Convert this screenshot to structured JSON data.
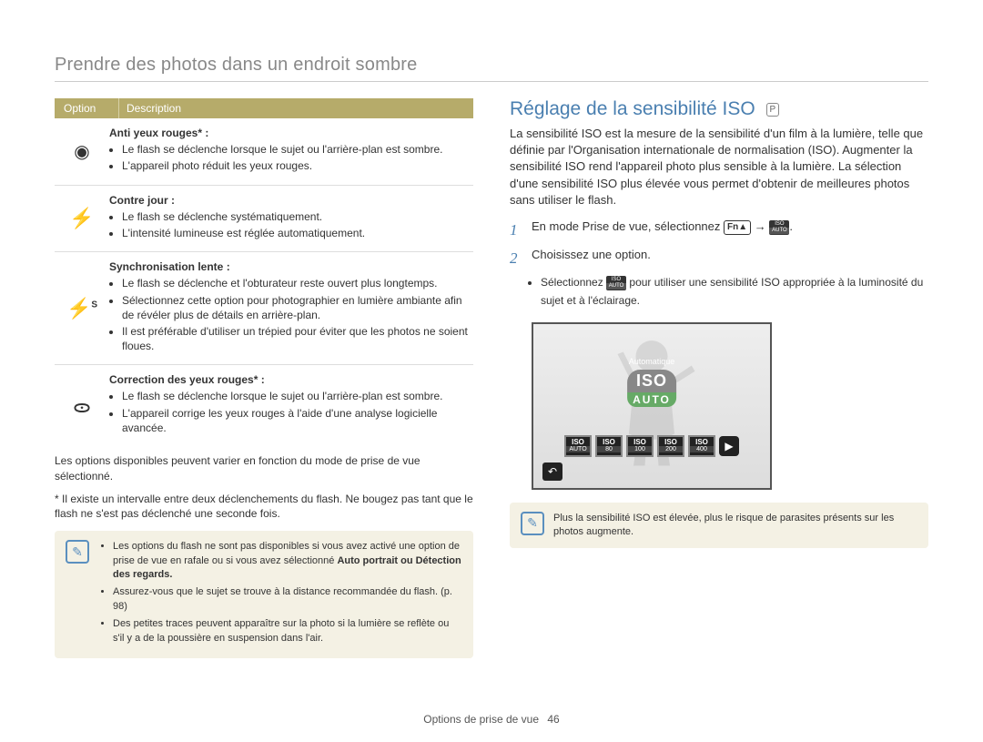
{
  "page_title": "Prendre des photos dans un endroit sombre",
  "table": {
    "header_option": "Option",
    "header_description": "Description",
    "rows": [
      {
        "icon": "eye-icon",
        "title": "Anti yeux rouges* :",
        "bullets": [
          "Le flash se déclenche lorsque le sujet ou l'arrière-plan est sombre.",
          "L'appareil photo réduit les yeux rouges."
        ]
      },
      {
        "icon": "flash-icon",
        "title": "Contre jour :",
        "bullets": [
          "Le flash se déclenche systématiquement.",
          "L'intensité lumineuse est réglée automatiquement."
        ]
      },
      {
        "icon": "flash-slow-icon",
        "title": "Synchronisation lente :",
        "bullets": [
          "Le flash se déclenche et l'obturateur reste ouvert plus longtemps.",
          "Sélectionnez cette option pour photographier en lumière ambiante afin de révéler plus de détails en arrière-plan.",
          "Il est préférable d'utiliser un trépied pour éviter que les photos ne soient floues."
        ]
      },
      {
        "icon": "eye-fix-icon",
        "title": "Correction des yeux rouges* :",
        "bullets": [
          "Le flash se déclenche lorsque le sujet ou l'arrière-plan est sombre.",
          "L'appareil corrige les yeux rouges à l'aide d'une analyse logicielle avancée."
        ]
      }
    ]
  },
  "footnotes": {
    "line1": "Les options disponibles peuvent varier en fonction du mode de prise de vue sélectionné.",
    "line2": "* Il existe un intervalle entre deux déclenchements du flash. Ne bougez pas tant que le flash ne s'est pas déclenché une seconde fois."
  },
  "left_note": {
    "bullets": [
      "Les options du flash ne sont pas disponibles si vous avez activé une option de prise de vue en rafale ou si vous avez sélectionné",
      "Assurez-vous que le sujet se trouve à la distance recommandée du flash. (p. 98)",
      "Des petites traces peuvent apparaître sur la photo si la lumière se reflète ou s'il y a de la poussière en suspension dans l'air."
    ],
    "bold_in_first": "Auto portrait ou Détection des regards."
  },
  "right": {
    "title": "Réglage de la sensibilité ISO",
    "mode_badge": "P",
    "paragraph": "La sensibilité ISO est la mesure de la sensibilité d'un film à la lumière, telle que définie par l'Organisation internationale de normalisation (ISO). Augmenter la sensibilité ISO rend l'appareil photo plus sensible à la lumière. La sélection d'une sensibilité ISO plus élevée vous permet d'obtenir de meilleures photos sans utiliser le flash.",
    "step1": "En mode Prise de vue, sélectionnez",
    "step1_fn": "Fn",
    "step1_arrow": "→",
    "step2": "Choisissez une option.",
    "step2_sub_pre": "Sélectionnez",
    "step2_sub_post": "pour utiliser une sensibilité ISO appropriée à la luminosité du sujet et à l'éclairage.",
    "screen": {
      "auto_label": "Automatique",
      "iso_big": "ISO",
      "iso_sub": "AUTO",
      "buttons": [
        {
          "top": "ISO",
          "bottom": "AUTO"
        },
        {
          "top": "ISO",
          "bottom": "80"
        },
        {
          "top": "ISO",
          "bottom": "100"
        },
        {
          "top": "ISO",
          "bottom": "200"
        },
        {
          "top": "ISO",
          "bottom": "400"
        }
      ],
      "arrow": "▶",
      "back": "↶"
    },
    "note": "Plus la sensibilité ISO est élevée, plus le risque de parasites présents sur les photos augmente."
  },
  "footer": {
    "section": "Options de prise de vue",
    "page": "46"
  }
}
